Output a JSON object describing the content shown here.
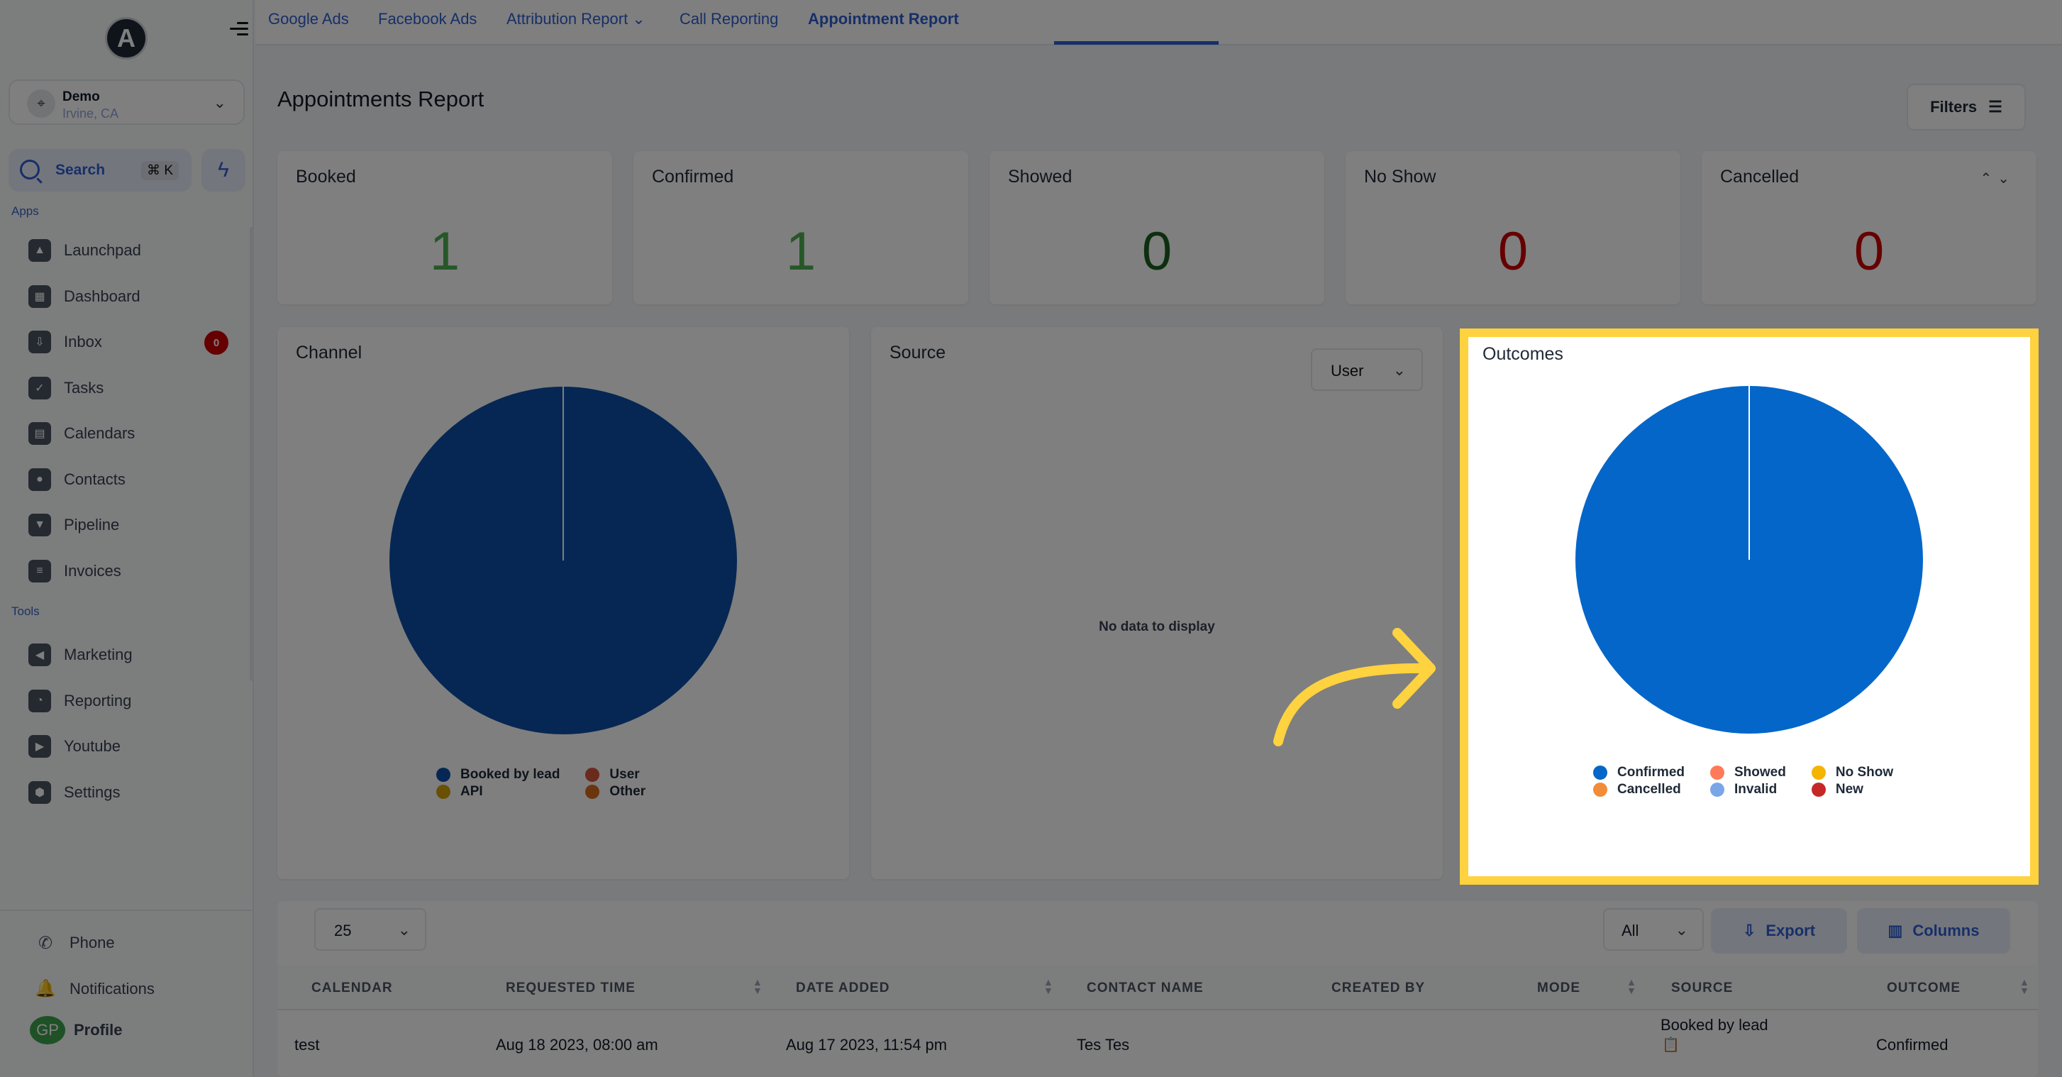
{
  "sidebar": {
    "logo_letter": "A",
    "location": {
      "name": "Demo",
      "sub": "Irvine, CA"
    },
    "search": {
      "label": "Search",
      "shortcut": "⌘ K"
    },
    "apps_label": "Apps",
    "apps": [
      {
        "label": "Launchpad",
        "icon": "launchpad-icon",
        "glyph": "▲"
      },
      {
        "label": "Dashboard",
        "icon": "dashboard-icon",
        "glyph": "▦"
      },
      {
        "label": "Inbox",
        "icon": "inbox-icon",
        "glyph": "⇩",
        "badge": "0"
      },
      {
        "label": "Tasks",
        "icon": "tasks-icon",
        "glyph": "✓"
      },
      {
        "label": "Calendars",
        "icon": "calendar-icon",
        "glyph": "▤"
      },
      {
        "label": "Contacts",
        "icon": "contacts-icon",
        "glyph": "●"
      },
      {
        "label": "Pipeline",
        "icon": "pipeline-icon",
        "glyph": "▼"
      },
      {
        "label": "Invoices",
        "icon": "invoices-icon",
        "glyph": "≡"
      }
    ],
    "tools_label": "Tools",
    "tools": [
      {
        "label": "Marketing",
        "icon": "megaphone-icon",
        "glyph": "◀"
      },
      {
        "label": "Reporting",
        "icon": "reporting-icon",
        "glyph": "◔"
      },
      {
        "label": "Youtube",
        "icon": "youtube-icon",
        "glyph": "▶"
      },
      {
        "label": "Settings",
        "icon": "settings-icon",
        "glyph": "⬢"
      }
    ],
    "bottom": [
      {
        "label": "Phone",
        "icon": "phone-icon",
        "glyph": "✆"
      },
      {
        "label": "Notifications",
        "icon": "bell-icon",
        "glyph": "🔔"
      }
    ],
    "profile": {
      "initials": "GP",
      "label": "Profile"
    }
  },
  "topnav": {
    "tabs": [
      {
        "label": "Google Ads"
      },
      {
        "label": "Facebook Ads"
      },
      {
        "label": "Attribution Report ⌄"
      },
      {
        "label": "Call Reporting"
      },
      {
        "label": "Appointment Report",
        "active": true
      }
    ]
  },
  "page": {
    "title": "Appointments Report",
    "filters_label": "Filters",
    "stats": [
      {
        "label": "Booked",
        "value": "1",
        "color": "#4caf50"
      },
      {
        "label": "Confirmed",
        "value": "1",
        "color": "#4caf50"
      },
      {
        "label": "Showed",
        "value": "0",
        "color": "#1b5e20"
      },
      {
        "label": "No Show",
        "value": "0",
        "color": "#cc0000"
      },
      {
        "label": "Cancelled",
        "value": "0",
        "color": "#cc0000"
      }
    ],
    "stat_arrows": "⌃⌄"
  },
  "chart_data": [
    {
      "type": "pie",
      "title": "Channel",
      "categories": [
        "Booked by lead",
        "User",
        "API",
        "Other"
      ],
      "values": [
        1,
        0,
        0,
        0
      ],
      "colors": [
        "#0d4ea6",
        "#d4553a",
        "#d4a00a",
        "#d66a1c"
      ],
      "legend": "bottom"
    },
    {
      "type": "pie",
      "title": "Source",
      "categories": [],
      "values": [],
      "empty_text": "No data to display",
      "select_value": "User"
    },
    {
      "type": "pie",
      "title": "Outcomes",
      "categories": [
        "Confirmed",
        "Showed",
        "No Show",
        "Cancelled",
        "Invalid",
        "New"
      ],
      "values": [
        1,
        0,
        0,
        0,
        0,
        0
      ],
      "colors": [
        "#0466c8",
        "#ff7a59",
        "#f4b400",
        "#f28c38",
        "#7aa6e8",
        "#c62828"
      ],
      "legend": "bottom"
    }
  ],
  "table": {
    "page_size": "25",
    "filter_value": "All",
    "export_label": "Export",
    "columns_label": "Columns",
    "headers": [
      "CALENDAR",
      "REQUESTED TIME",
      "DATE ADDED",
      "CONTACT NAME",
      "CREATED BY",
      "MODE",
      "SOURCE",
      "OUTCOME"
    ],
    "rows": [
      {
        "calendar": "test",
        "requested_time": "Aug 18 2023, 08:00 am",
        "date_added": "Aug 17 2023, 11:54 pm",
        "contact_name": "Tes Tes",
        "created_by": "",
        "mode": "",
        "source": "Booked by lead",
        "outcome": "Confirmed"
      }
    ]
  }
}
